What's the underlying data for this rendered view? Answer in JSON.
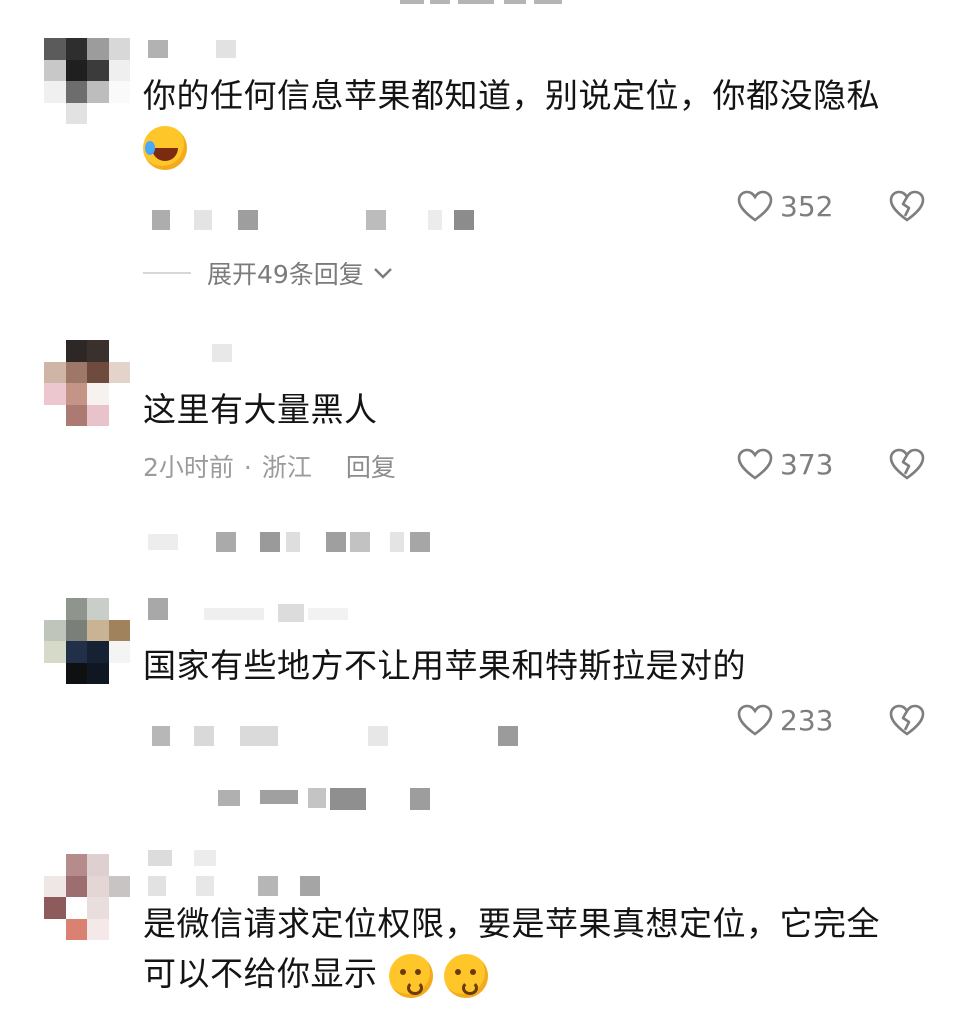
{
  "comments": [
    {
      "text": "你的任何信息苹果都知道，别说定位，你都没隐私",
      "emoji": [
        "laughing-tears-emoji"
      ],
      "likes": "352",
      "expand_label": "展开49条回复"
    },
    {
      "text": "这里有大量黑人",
      "meta": {
        "time": "2小时前",
        "dot": "·",
        "location": "浙江",
        "reply": "回复"
      },
      "likes": "373"
    },
    {
      "text": "国家有些地方不让用苹果和特斯拉是对的",
      "likes": "233"
    },
    {
      "text_line1": "是微信请求定位权限，要是苹果真想定位，它完全",
      "text_line2": "可以不给你显示",
      "emoji": [
        "blushing-kiss-emoji",
        "blushing-kiss-emoji"
      ]
    }
  ],
  "icons": {
    "like": "heart-outline-icon",
    "dislike": "broken-heart-icon",
    "expand": "chevron-down-icon"
  },
  "colors": {
    "text": "#141414",
    "meta": "#9b9b9b",
    "icon": "#7e7e7e",
    "emoji": "#ffc62a"
  }
}
